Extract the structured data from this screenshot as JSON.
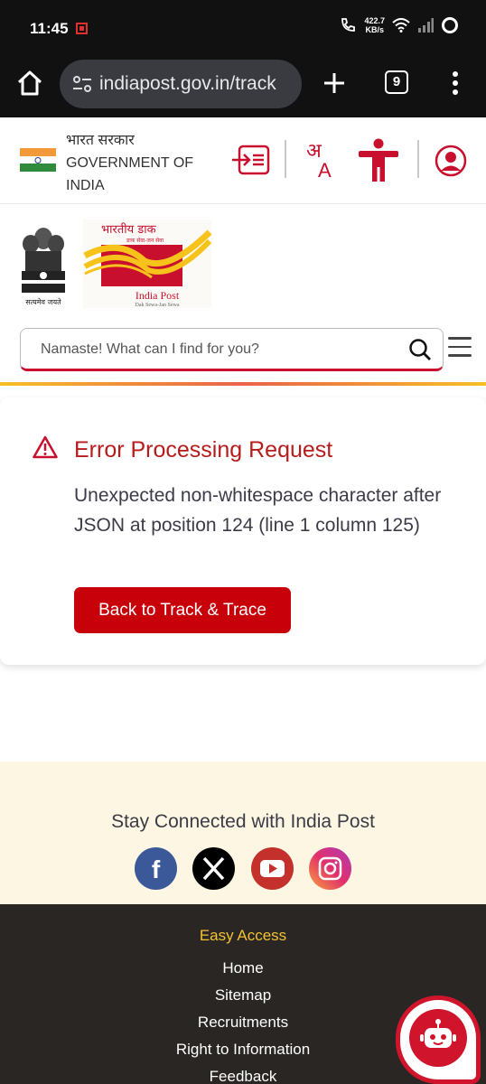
{
  "status_bar": {
    "time": "11:45",
    "speed_value": "422.7",
    "speed_unit": "KB/s"
  },
  "browser": {
    "url": "indiapost.gov.in/track",
    "tab_count": "9"
  },
  "gov_header": {
    "hindi_name": "भारत सरकार",
    "english_name_line1": "GOVERNMENT OF",
    "english_name_line2": "INDIA",
    "emblem_motto": "सत्यमेव जयते",
    "logo_hindi": "भारतीय डाक",
    "logo_hindi_tagline": "डाक सेवा-जन सेवा",
    "logo_name": "India Post",
    "logo_tagline": "Dak Sewa-Jan Sewa"
  },
  "search": {
    "placeholder": "Namaste! What can I find for you?"
  },
  "error": {
    "title": "Error Processing Request",
    "message": "Unexpected non-whitespace character after JSON at position 124 (line 1 column 125)",
    "button_label": "Back to Track & Trace"
  },
  "connect": {
    "title": "Stay Connected with India Post",
    "socials": [
      "facebook-icon",
      "x-icon",
      "youtube-icon",
      "instagram-icon"
    ]
  },
  "footer": {
    "easy_access_title": "Easy Access",
    "links": [
      "Home",
      "Sitemap",
      "Recruitments",
      "Right to Information",
      "Feedback"
    ]
  },
  "colors": {
    "brand_red": "#c8000a",
    "error_title": "#b71c1c",
    "footer_bg": "#2a2624",
    "connect_bg": "#fdf6e3",
    "accent_yellow": "#f2c230"
  }
}
